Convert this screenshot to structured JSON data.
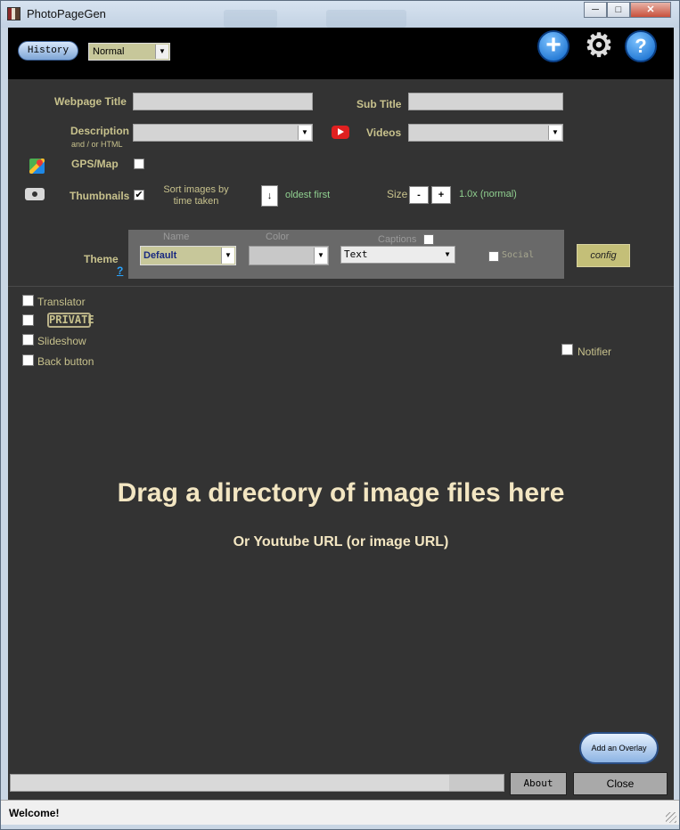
{
  "window": {
    "title": "PhotoPageGen"
  },
  "toolbar": {
    "history_label": "History",
    "mode_value": "Normal",
    "add_icon": "plus-icon",
    "settings_icon": "gear-icon",
    "help_icon": "help-icon"
  },
  "form": {
    "webpage_title_label": "Webpage Title",
    "sub_title_label": "Sub Title",
    "description_label": "Description",
    "description_hint": "and / or HTML",
    "videos_label": "Videos",
    "gps_label": "GPS/Map",
    "gps_checked": false,
    "thumbnails_label": "Thumbnails",
    "thumbnails_checked": true,
    "sort_label": "Sort images by time taken",
    "sort_arrow": "↓",
    "sort_order": "oldest first",
    "size_label": "Size",
    "size_minus": "-",
    "size_plus": "+",
    "size_value": "1.0x (normal)"
  },
  "theme": {
    "label": "Theme",
    "help_link": "?",
    "name_header": "Name",
    "color_header": "Color",
    "captions_header": "Captions",
    "name_value": "Default",
    "color_value": "",
    "captions_value": "Text",
    "social_label": "Social",
    "config_label": "config"
  },
  "options": {
    "translator_label": "Translator",
    "private_label": "PRIVATE",
    "slideshow_label": "Slideshow",
    "back_button_label": "Back button",
    "notifier_label": "Notifier"
  },
  "dropzone": {
    "main_text": "Drag a directory of image files here",
    "sub_text": "Or Youtube URL (or image URL)"
  },
  "bottom": {
    "overlay_label": "Add an Overlay",
    "about_label": "About",
    "close_label": "Close",
    "progress": 0.89,
    "status_text": "Welcome!"
  },
  "colors": {
    "background": "#333333",
    "label_gold": "#c8c28d",
    "accent_green": "#90d090",
    "drop_text": "#f3e6c2"
  }
}
